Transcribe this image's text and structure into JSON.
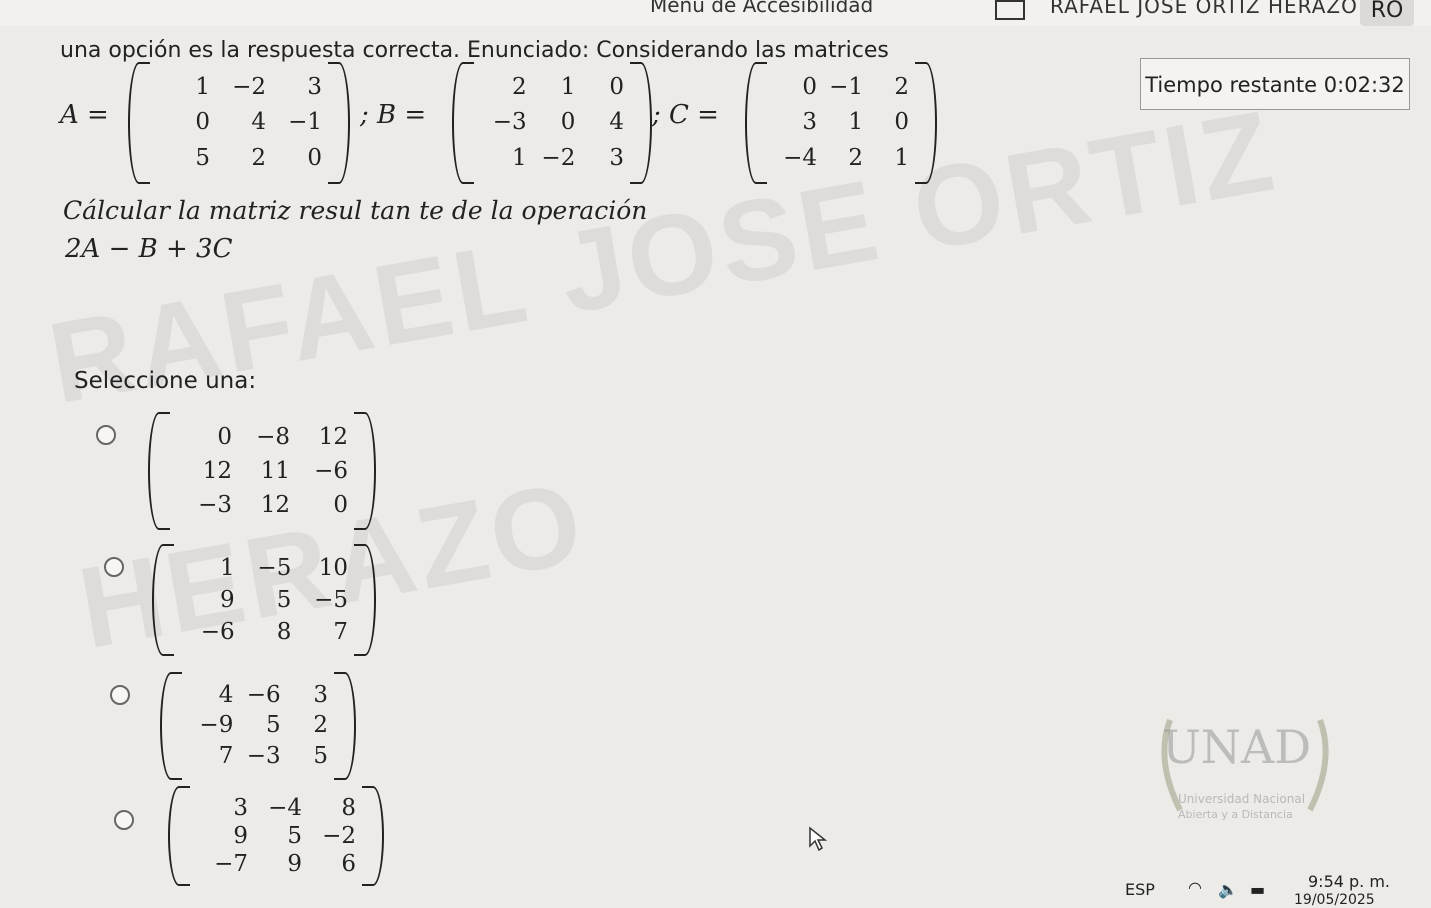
{
  "topbar": {
    "accessibility": "Menú de Accesibilidad",
    "user_name": "RAFAEL JOSÉ ORTIZ HERAZO",
    "user_initials": "RO"
  },
  "question": {
    "prompt": "una opción es la respuesta correcta. Enunciado: Considerando las matrices",
    "matrix_A_label": "A =",
    "matrix_B_label": "; B =",
    "matrix_C_label": "; C =",
    "matrix_A": [
      [
        "1",
        "−2",
        "3"
      ],
      [
        "0",
        "4",
        "−1"
      ],
      [
        "5",
        "2",
        "0"
      ]
    ],
    "matrix_B": [
      [
        "2",
        "1",
        "0"
      ],
      [
        "−3",
        "0",
        "4"
      ],
      [
        "1",
        "−2",
        "3"
      ]
    ],
    "matrix_C": [
      [
        "0",
        "−1",
        "2"
      ],
      [
        "3",
        "1",
        "0"
      ],
      [
        "−4",
        "2",
        "1"
      ]
    ],
    "instruction": "Cálcular la matriz resul tan te de la operación",
    "expression": "2A − B + 3C"
  },
  "timer": {
    "label": "Tiempo restante",
    "value": "0:02:32"
  },
  "options_label": "Seleccione una:",
  "options": [
    [
      [
        "0",
        "−8",
        "12"
      ],
      [
        "12",
        "11",
        "−6"
      ],
      [
        "−3",
        "12",
        "0"
      ]
    ],
    [
      [
        "1",
        "−5",
        "10"
      ],
      [
        "9",
        "5",
        "−5"
      ],
      [
        "−6",
        "8",
        "7"
      ]
    ],
    [
      [
        "4",
        "−6",
        "3"
      ],
      [
        "−9",
        "5",
        "2"
      ],
      [
        "7",
        "−3",
        "5"
      ]
    ],
    [
      [
        "3",
        "−4",
        "8"
      ],
      [
        "9",
        "5",
        "−2"
      ],
      [
        "−7",
        "9",
        "6"
      ]
    ]
  ],
  "watermark": {
    "line1": "RAFAEL JOSE ORTIZ",
    "line2": "HERAZO"
  },
  "logo": {
    "name": "UNAD",
    "subtitle1": "Universidad Nacional",
    "subtitle2": "Abierta y a Distancia"
  },
  "taskbar": {
    "lang": "ESP",
    "time": "9:54 p. m.",
    "date": "19/05/2025"
  }
}
